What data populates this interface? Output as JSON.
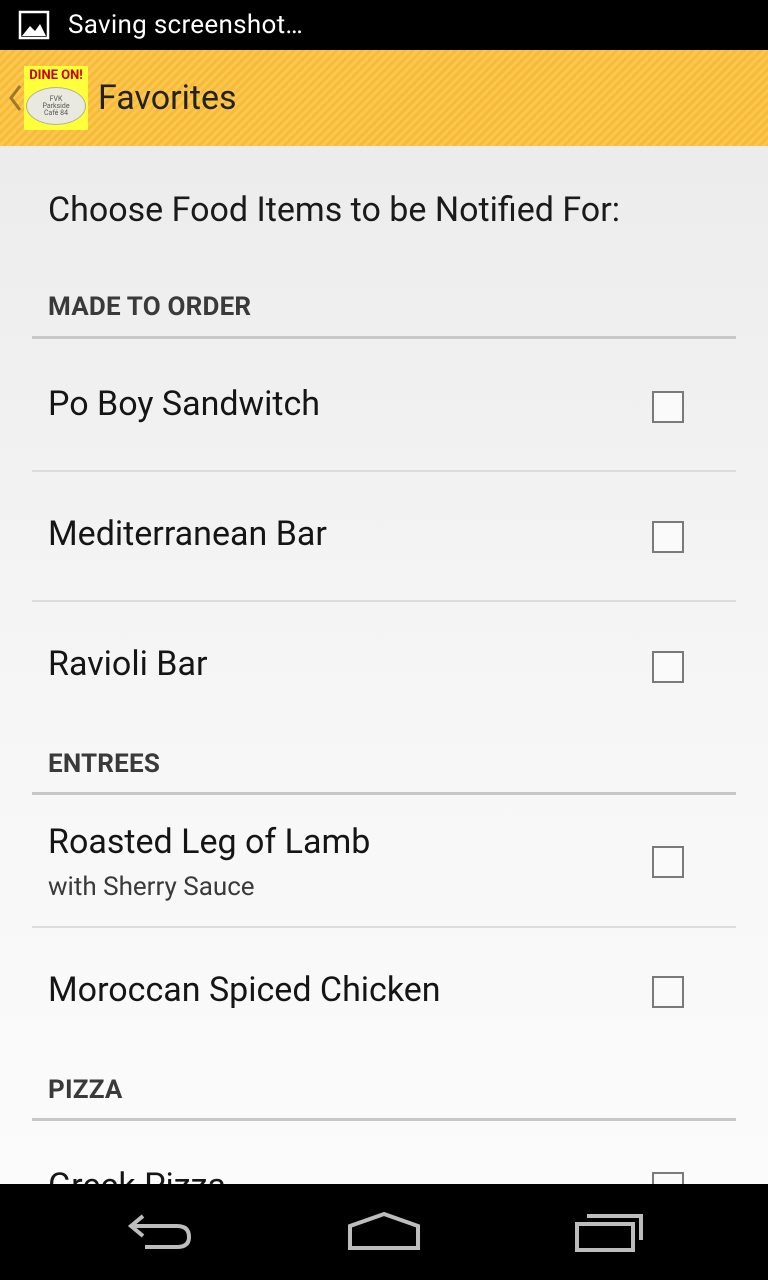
{
  "status_bar": {
    "text": "Saving screenshot…",
    "icon": "image-icon"
  },
  "action_bar": {
    "title": "Favorites",
    "back_icon": "chevron-left-icon",
    "logo": {
      "top_text": "DINE ON!",
      "plate_line1": "FVK",
      "plate_line2": "Parkside",
      "plate_line3": "Café 84"
    }
  },
  "content": {
    "prompt": "Choose Food Items to be Notified For:",
    "sections": [
      {
        "header": "MADE TO ORDER",
        "items": [
          {
            "title": "Po Boy Sandwitch",
            "subtitle": "",
            "checked": false
          },
          {
            "title": "Mediterranean Bar",
            "subtitle": "",
            "checked": false
          },
          {
            "title": "Ravioli Bar",
            "subtitle": "",
            "checked": false
          }
        ]
      },
      {
        "header": "ENTREES",
        "items": [
          {
            "title": "Roasted Leg of Lamb",
            "subtitle": "with Sherry Sauce",
            "checked": false
          },
          {
            "title": "Moroccan Spiced Chicken",
            "subtitle": "",
            "checked": false
          }
        ]
      },
      {
        "header": "PIZZA",
        "items": [
          {
            "title": "Greek Pizza",
            "subtitle": "",
            "checked": false
          }
        ]
      }
    ]
  },
  "nav_bar": {
    "back_icon": "back-arrow-icon",
    "home_icon": "home-icon",
    "recents_icon": "recent-apps-icon"
  },
  "colors": {
    "action_bar": "#fcbf3b",
    "logo_background": "#ffff3a",
    "logo_text": "#d10000"
  }
}
